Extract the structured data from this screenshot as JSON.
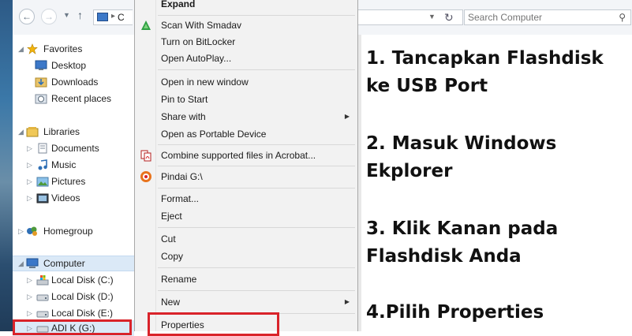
{
  "explorer": {
    "address_fragment": "C",
    "search_placeholder": "Search Computer"
  },
  "nav": {
    "favorites": "Favorites",
    "desktop": "Desktop",
    "downloads": "Downloads",
    "recent_places": "Recent places",
    "libraries": "Libraries",
    "documents": "Documents",
    "music": "Music",
    "pictures": "Pictures",
    "videos": "Videos",
    "homegroup": "Homegroup",
    "computer": "Computer",
    "local_disk_c": "Local Disk (C:)",
    "local_disk_d": "Local Disk (D:)",
    "local_disk_e": "Local Disk (E:)",
    "adi_k_g": "ADI K (G:)"
  },
  "menu": {
    "expand": "Expand",
    "scan_smadav": "Scan With Smadav",
    "bitlocker": "Turn on BitLocker",
    "autoplay": "Open AutoPlay...",
    "open_new_window": "Open in new window",
    "pin_start": "Pin to Start",
    "share_with": "Share with",
    "open_portable": "Open as Portable Device",
    "combine_acrobat": "Combine supported files in Acrobat...",
    "pindai": "Pindai G:\\",
    "format": "Format...",
    "eject": "Eject",
    "cut": "Cut",
    "copy": "Copy",
    "rename": "Rename",
    "new": "New",
    "properties": "Properties"
  },
  "steps": {
    "s1_line1": "1. Tancapkan Flashdisk",
    "s1_line2": "ke USB Port",
    "s2_line1": "2. Masuk Windows",
    "s2_line2": "Ekplorer",
    "s3_line1": "3. Klik Kanan pada",
    "s3_line2": "Flashdisk Anda",
    "s4_line1": "4.Pilih Properties"
  },
  "colors": {
    "highlight_red": "#d9232a",
    "selected_nav": "#dbe9f7"
  }
}
